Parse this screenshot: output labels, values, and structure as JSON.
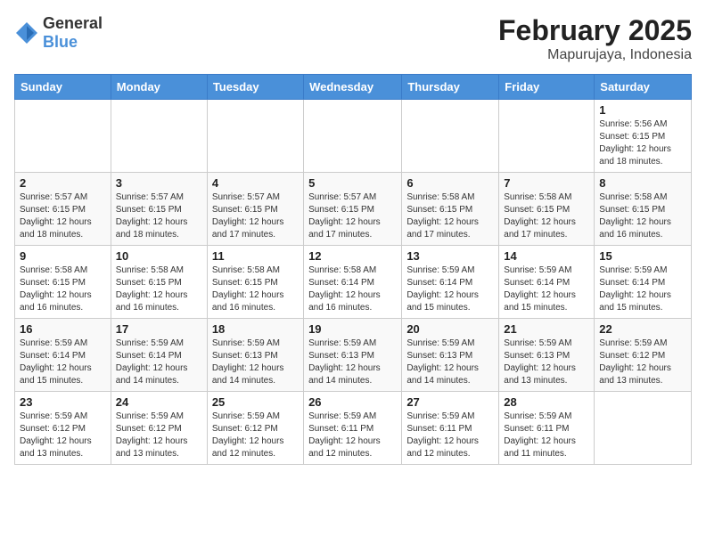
{
  "header": {
    "logo_general": "General",
    "logo_blue": "Blue",
    "month_year": "February 2025",
    "location": "Mapurujaya, Indonesia"
  },
  "days_of_week": [
    "Sunday",
    "Monday",
    "Tuesday",
    "Wednesday",
    "Thursday",
    "Friday",
    "Saturday"
  ],
  "weeks": [
    [
      {
        "day": "",
        "info": ""
      },
      {
        "day": "",
        "info": ""
      },
      {
        "day": "",
        "info": ""
      },
      {
        "day": "",
        "info": ""
      },
      {
        "day": "",
        "info": ""
      },
      {
        "day": "",
        "info": ""
      },
      {
        "day": "1",
        "info": "Sunrise: 5:56 AM\nSunset: 6:15 PM\nDaylight: 12 hours\nand 18 minutes."
      }
    ],
    [
      {
        "day": "2",
        "info": "Sunrise: 5:57 AM\nSunset: 6:15 PM\nDaylight: 12 hours\nand 18 minutes."
      },
      {
        "day": "3",
        "info": "Sunrise: 5:57 AM\nSunset: 6:15 PM\nDaylight: 12 hours\nand 18 minutes."
      },
      {
        "day": "4",
        "info": "Sunrise: 5:57 AM\nSunset: 6:15 PM\nDaylight: 12 hours\nand 17 minutes."
      },
      {
        "day": "5",
        "info": "Sunrise: 5:57 AM\nSunset: 6:15 PM\nDaylight: 12 hours\nand 17 minutes."
      },
      {
        "day": "6",
        "info": "Sunrise: 5:58 AM\nSunset: 6:15 PM\nDaylight: 12 hours\nand 17 minutes."
      },
      {
        "day": "7",
        "info": "Sunrise: 5:58 AM\nSunset: 6:15 PM\nDaylight: 12 hours\nand 17 minutes."
      },
      {
        "day": "8",
        "info": "Sunrise: 5:58 AM\nSunset: 6:15 PM\nDaylight: 12 hours\nand 16 minutes."
      }
    ],
    [
      {
        "day": "9",
        "info": "Sunrise: 5:58 AM\nSunset: 6:15 PM\nDaylight: 12 hours\nand 16 minutes."
      },
      {
        "day": "10",
        "info": "Sunrise: 5:58 AM\nSunset: 6:15 PM\nDaylight: 12 hours\nand 16 minutes."
      },
      {
        "day": "11",
        "info": "Sunrise: 5:58 AM\nSunset: 6:15 PM\nDaylight: 12 hours\nand 16 minutes."
      },
      {
        "day": "12",
        "info": "Sunrise: 5:58 AM\nSunset: 6:14 PM\nDaylight: 12 hours\nand 16 minutes."
      },
      {
        "day": "13",
        "info": "Sunrise: 5:59 AM\nSunset: 6:14 PM\nDaylight: 12 hours\nand 15 minutes."
      },
      {
        "day": "14",
        "info": "Sunrise: 5:59 AM\nSunset: 6:14 PM\nDaylight: 12 hours\nand 15 minutes."
      },
      {
        "day": "15",
        "info": "Sunrise: 5:59 AM\nSunset: 6:14 PM\nDaylight: 12 hours\nand 15 minutes."
      }
    ],
    [
      {
        "day": "16",
        "info": "Sunrise: 5:59 AM\nSunset: 6:14 PM\nDaylight: 12 hours\nand 15 minutes."
      },
      {
        "day": "17",
        "info": "Sunrise: 5:59 AM\nSunset: 6:14 PM\nDaylight: 12 hours\nand 14 minutes."
      },
      {
        "day": "18",
        "info": "Sunrise: 5:59 AM\nSunset: 6:13 PM\nDaylight: 12 hours\nand 14 minutes."
      },
      {
        "day": "19",
        "info": "Sunrise: 5:59 AM\nSunset: 6:13 PM\nDaylight: 12 hours\nand 14 minutes."
      },
      {
        "day": "20",
        "info": "Sunrise: 5:59 AM\nSunset: 6:13 PM\nDaylight: 12 hours\nand 14 minutes."
      },
      {
        "day": "21",
        "info": "Sunrise: 5:59 AM\nSunset: 6:13 PM\nDaylight: 12 hours\nand 13 minutes."
      },
      {
        "day": "22",
        "info": "Sunrise: 5:59 AM\nSunset: 6:12 PM\nDaylight: 12 hours\nand 13 minutes."
      }
    ],
    [
      {
        "day": "23",
        "info": "Sunrise: 5:59 AM\nSunset: 6:12 PM\nDaylight: 12 hours\nand 13 minutes."
      },
      {
        "day": "24",
        "info": "Sunrise: 5:59 AM\nSunset: 6:12 PM\nDaylight: 12 hours\nand 13 minutes."
      },
      {
        "day": "25",
        "info": "Sunrise: 5:59 AM\nSunset: 6:12 PM\nDaylight: 12 hours\nand 12 minutes."
      },
      {
        "day": "26",
        "info": "Sunrise: 5:59 AM\nSunset: 6:11 PM\nDaylight: 12 hours\nand 12 minutes."
      },
      {
        "day": "27",
        "info": "Sunrise: 5:59 AM\nSunset: 6:11 PM\nDaylight: 12 hours\nand 12 minutes."
      },
      {
        "day": "28",
        "info": "Sunrise: 5:59 AM\nSunset: 6:11 PM\nDaylight: 12 hours\nand 11 minutes."
      },
      {
        "day": "",
        "info": ""
      }
    ]
  ]
}
